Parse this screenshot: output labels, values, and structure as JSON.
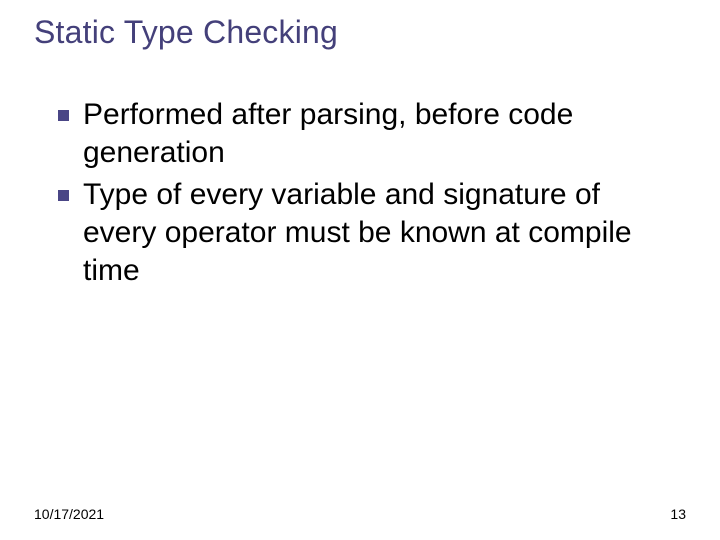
{
  "title": "Static Type Checking",
  "bullets": [
    "Performed after parsing, before code generation",
    "Type of every variable and signature of every operator must be known at compile time"
  ],
  "footer": {
    "date": "10/17/2021",
    "page": "13"
  },
  "colors": {
    "title": "#44407a",
    "bullet": "#4a4686"
  }
}
